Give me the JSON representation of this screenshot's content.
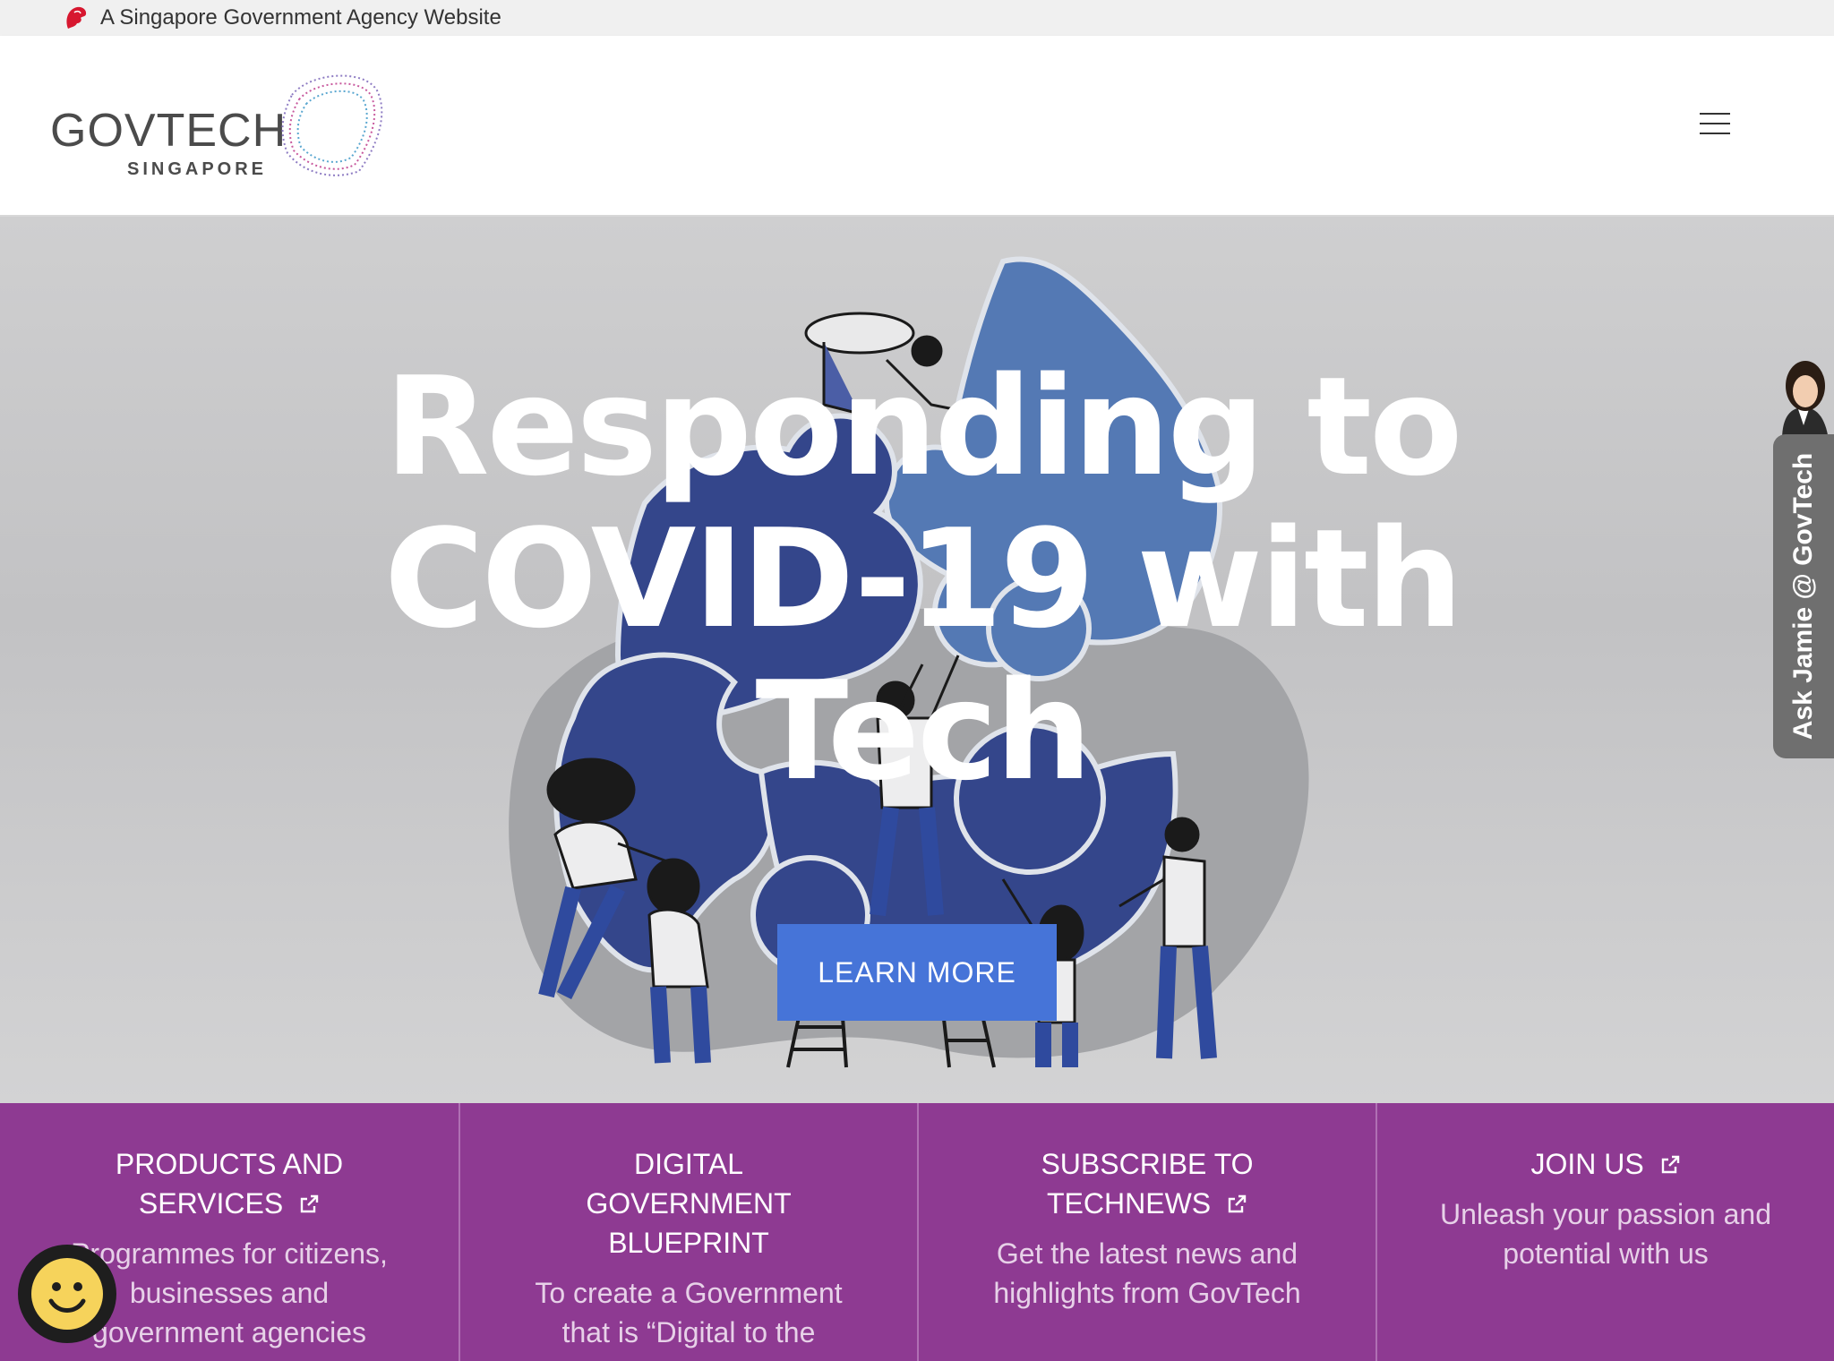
{
  "masthead": {
    "text": "A Singapore Government Agency Website",
    "icon": "lion-head-icon",
    "icon_color": "#d7172f"
  },
  "header": {
    "logo_word": "GOVTECH",
    "logo_sub": "SINGAPORE",
    "menu_icon": "hamburger-menu-icon"
  },
  "hero": {
    "title": "Responding to COVID-19 with Tech",
    "cta_label": "LEARN MORE",
    "cta_color": "#4674d8"
  },
  "ask_jamie": {
    "label": "Ask Jamie @ GovTech",
    "icon": "jamie-avatar-icon"
  },
  "tiles": [
    {
      "title": "PRODUCTS AND SERVICES",
      "external": true,
      "description": "Programmes for citizens, businesses and government agencies"
    },
    {
      "title": "DIGITAL GOVERNMENT BLUEPRINT",
      "external": false,
      "description": "To create a Government that is “Digital to the"
    },
    {
      "title": "SUBSCRIBE TO TECHNEWS",
      "external": true,
      "description": "Get the latest news and highlights from GovTech"
    },
    {
      "title": "JOIN US",
      "external": true,
      "description": "Unleash your passion and potential with us"
    }
  ],
  "colors": {
    "tiles_bg": "#8e3a92",
    "puzzle_dark": "#34468b",
    "puzzle_light": "#5479b4"
  },
  "feedback": {
    "icon": "smiley-face-icon"
  }
}
